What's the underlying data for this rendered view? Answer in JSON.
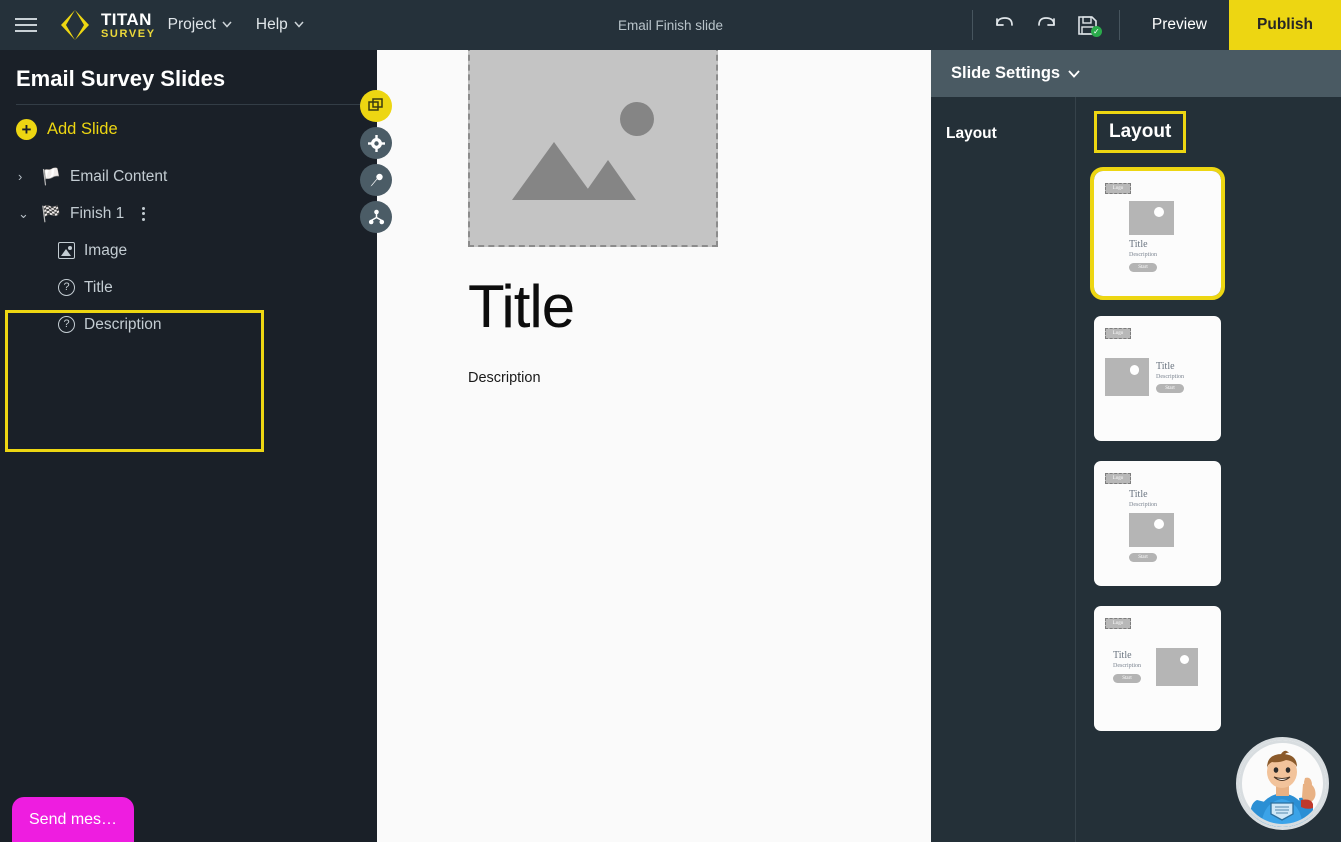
{
  "topbar": {
    "hamburger_icon": "hamburger-menu-icon",
    "logo": {
      "mark": "titan-logo-icon",
      "primary": "TITAN",
      "secondary": "SURVEY"
    },
    "menus": [
      {
        "label": "Project",
        "caret": "⌄"
      },
      {
        "label": "Help",
        "caret": "⌄"
      }
    ],
    "doc_title": "Email Finish slide",
    "undo_icon": "undo-arrow-icon",
    "redo_icon": "redo-arrow-icon",
    "save_icon": "save-floppy-disk-icon",
    "save_status_icon": "✓",
    "preview_label": "Preview",
    "publish_label": "Publish",
    "publish_color": "#edd612"
  },
  "sidebar": {
    "title": "Email Survey Slides",
    "add_slide_label": "Add Slide",
    "add_slide_icon": "+",
    "accent_color": "#edd612",
    "tree": [
      {
        "label": "Email Content",
        "icon": "🏳️",
        "chevron": "›",
        "expanded": false
      },
      {
        "label": "Finish 1",
        "icon": "🏁",
        "chevron": "⌄",
        "expanded": true,
        "children": [
          {
            "label": "Image",
            "icon": "image-placeholder-icon"
          },
          {
            "label": "Title",
            "icon": "question-circle-icon"
          },
          {
            "label": "Description",
            "icon": "question-circle-icon"
          }
        ]
      }
    ]
  },
  "fabs": [
    {
      "name": "duplicate-layers-icon",
      "active": true
    },
    {
      "name": "gear-settings-icon",
      "active": false
    },
    {
      "name": "paint-brush-icon",
      "active": false
    },
    {
      "name": "node-hierarchy-icon",
      "active": false
    }
  ],
  "canvas": {
    "image_placeholder_icon": "image-placeholder-icon",
    "title": "Title",
    "description": "Description",
    "background": "#fafafa"
  },
  "right_panel": {
    "header": "Slide Settings",
    "header_caret": "⌄",
    "nav": [
      {
        "label": "Layout"
      }
    ],
    "section_title": "Layout",
    "thumbnails": [
      {
        "id": "layout-centered",
        "selected": true,
        "logo": "Logo",
        "title": "Title",
        "description": "Description",
        "button": "Start"
      },
      {
        "id": "layout-image-left",
        "selected": false,
        "logo": "Logo",
        "title": "Title",
        "description": "Description",
        "button": "Start"
      },
      {
        "id": "layout-text-top",
        "selected": false,
        "logo": "Logo",
        "title": "Title",
        "description": "Description",
        "button": "Start"
      },
      {
        "id": "layout-image-right",
        "selected": false,
        "logo": "Logo",
        "title": "Title",
        "description": "Description",
        "button": "Start"
      }
    ]
  },
  "chat": {
    "button_label": "Send mes…",
    "button_color": "#ee1de0",
    "mascot_icon": "superhero-mascot-avatar"
  }
}
